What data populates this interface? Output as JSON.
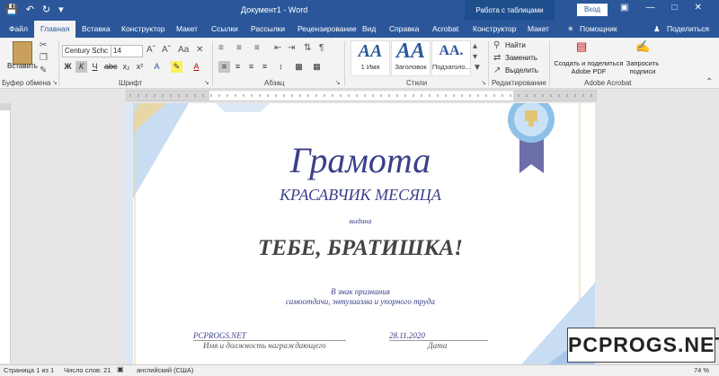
{
  "titlebar": {
    "document_title": "Документ1 - Word",
    "table_tools": "Работа с таблицами",
    "login_button": "Вход",
    "bg_color": "#2b579a"
  },
  "tabs": [
    {
      "label": "Файл"
    },
    {
      "label": "Главная"
    },
    {
      "label": "Вставка"
    },
    {
      "label": "Конструктор"
    },
    {
      "label": "Макет"
    },
    {
      "label": "Ссылки"
    },
    {
      "label": "Рассылки"
    },
    {
      "label": "Рецензирование"
    },
    {
      "label": "Вид"
    },
    {
      "label": "Справка"
    },
    {
      "label": "Acrobat"
    },
    {
      "label": "Конструктор"
    },
    {
      "label": "Макет"
    },
    {
      "label": "Помощник"
    },
    {
      "label": "Поделиться"
    }
  ],
  "ribbon": {
    "clipboard": {
      "paste_label": "Вставить",
      "group_label": "Буфер обмена"
    },
    "font": {
      "font_name": "Century Schc",
      "font_size": "14",
      "group_label": "Шрифт"
    },
    "paragraph": {
      "group_label": "Абзац"
    },
    "styles": {
      "group_label": "Стили",
      "items": [
        {
          "preview": "АА",
          "name": "1 Имя"
        },
        {
          "preview": "АА",
          "name": "Заголовок"
        },
        {
          "preview": "АА.",
          "name": "Подзаголо..."
        }
      ]
    },
    "editing": {
      "find": "Найти",
      "replace": "Заменить",
      "select": "Выделить",
      "group_label": "Редактирование"
    },
    "acrobat": {
      "create_share": "Создать и поделиться Adobe PDF",
      "request_signatures": "Запросить подписи",
      "group_label": "Adobe Acrobat"
    }
  },
  "certificate": {
    "title": "Грамота",
    "subtitle": "КРАСАВЧИК МЕСЯЦА",
    "issued": "выдана",
    "recipient": "ТЕБЕ, БРАТИШКА!",
    "recognition_line1": "В знак признания",
    "recognition_line2": "самоотдачи, энтузиазма и упорного труда",
    "signer": "PCPROGS.NET",
    "signer_caption": "Имя и должность награждающего",
    "date": "28.11.2020",
    "date_caption": "Дата"
  },
  "status": {
    "page": "Страница 1 из 1",
    "words": "Число слов: 21",
    "language": "английский (США)",
    "zoom": "74 %"
  },
  "watermark": "PCPROGS.NET"
}
